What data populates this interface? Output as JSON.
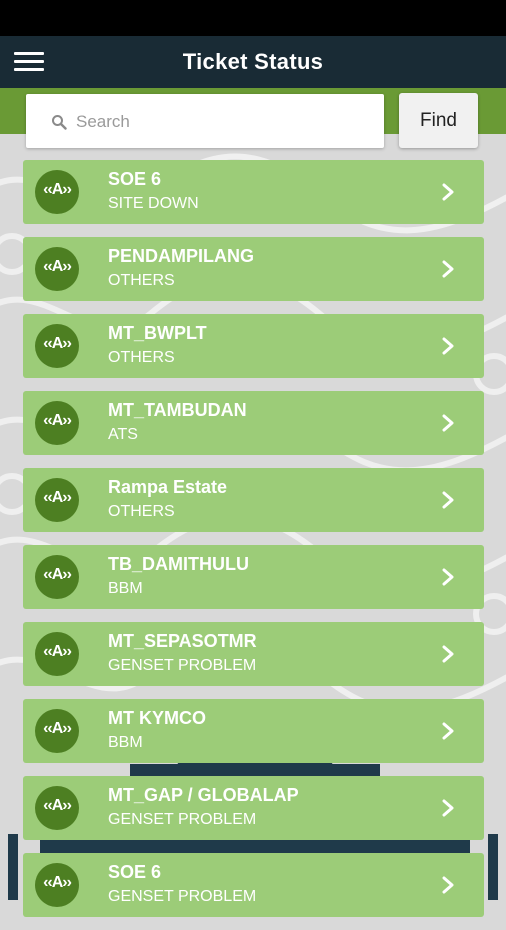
{
  "header": {
    "title": "Ticket Status",
    "menu_icon": "hamburger-menu-icon"
  },
  "search": {
    "placeholder": "Search",
    "value": "",
    "icon": "search-icon",
    "button_label": "Find"
  },
  "colors": {
    "app_bar": "#192b35",
    "accent_band": "#6a9a35",
    "ticket_background": "#9ccc78",
    "ticket_icon_background": "#4d7f22"
  },
  "tickets": [
    {
      "name": "SOE 6",
      "category": "SITE DOWN",
      "icon": "antenna-tower-icon"
    },
    {
      "name": "PENDAMPILANG",
      "category": "OTHERS",
      "icon": "antenna-tower-icon"
    },
    {
      "name": "MT_BWPLT",
      "category": "OTHERS",
      "icon": "antenna-tower-icon"
    },
    {
      "name": "MT_TAMBUDAN",
      "category": "ATS",
      "icon": "antenna-tower-icon"
    },
    {
      "name": "Rampa Estate",
      "category": "OTHERS",
      "icon": "antenna-tower-icon"
    },
    {
      "name": "TB_DAMITHULU",
      "category": "BBM",
      "icon": "antenna-tower-icon"
    },
    {
      "name": "MT_SEPASOTMR",
      "category": "GENSET PROBLEM",
      "icon": "antenna-tower-icon"
    },
    {
      "name": "MT KYMCO",
      "category": "BBM",
      "icon": "antenna-tower-icon"
    },
    {
      "name": "MT_GAP / GLOBALAP",
      "category": "GENSET PROBLEM",
      "icon": "antenna-tower-icon"
    },
    {
      "name": "SOE 6",
      "category": "GENSET PROBLEM",
      "icon": "antenna-tower-icon"
    }
  ]
}
